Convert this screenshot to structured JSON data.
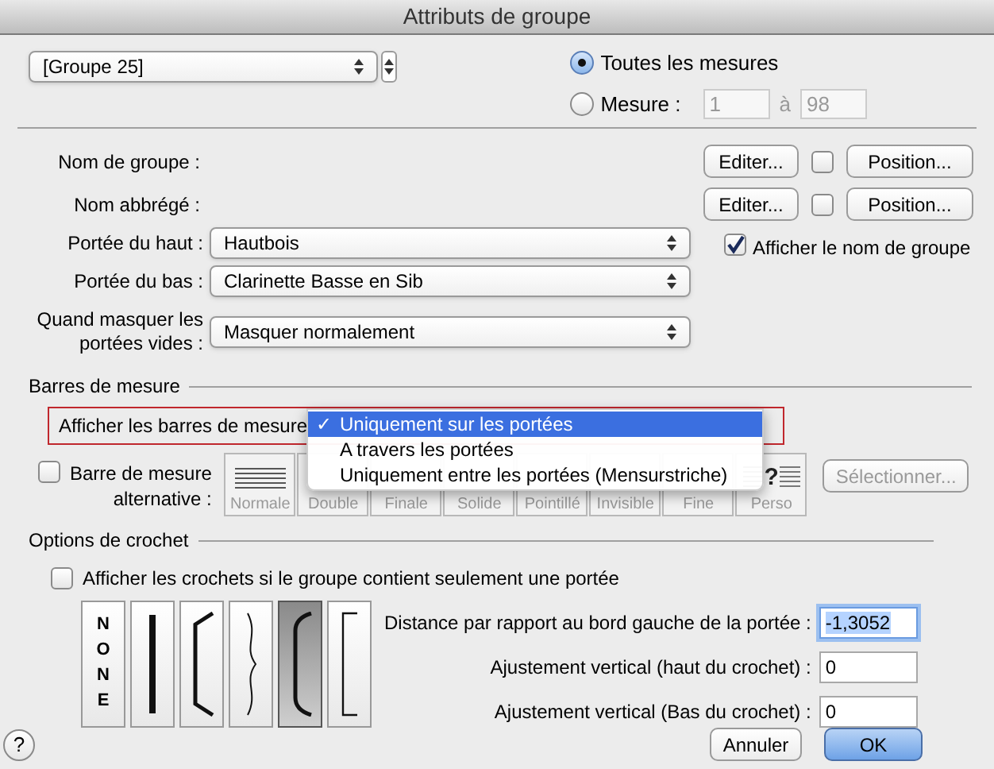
{
  "window": {
    "title": "Attributs de groupe"
  },
  "group_select": {
    "value": "[Groupe 25]"
  },
  "range": {
    "options": [
      {
        "label": "Toutes les mesures",
        "selected": true
      },
      {
        "label": "Mesure :",
        "selected": false
      }
    ],
    "from": "1",
    "to_label": "à",
    "to": "98"
  },
  "names": [
    {
      "label": "Nom de groupe :",
      "edit_button": "Editer...",
      "checked": false,
      "position_button": "Position..."
    },
    {
      "label": "Nom abbrégé :",
      "edit_button": "Editer...",
      "checked": false,
      "position_button": "Position..."
    }
  ],
  "staves": [
    {
      "label": "Portée du haut :",
      "value": "Hautbois"
    },
    {
      "label": "Portée du bas :",
      "value": "Clarinette Basse en Sib"
    },
    {
      "label": "Quand masquer les\nportées vides :",
      "value": "Masquer normalement"
    }
  ],
  "show_group_name": {
    "label": "Afficher le nom de groupe",
    "checked": true
  },
  "barlines": {
    "title": "Barres de mesure",
    "show_label": "Afficher les barres de mesure",
    "check_mark": "✓",
    "menu": [
      {
        "label": "Uniquement sur les portées",
        "selected": true
      },
      {
        "label": "A travers les portées",
        "selected": false
      },
      {
        "label": "Uniquement entre les portées (Mensurstriche)",
        "selected": false
      }
    ],
    "alternative": {
      "label": "Barre de mesure\nalternative :",
      "checked": false
    },
    "styles": [
      {
        "label": "Normale",
        "kind": "normal"
      },
      {
        "label": "Double",
        "kind": "double"
      },
      {
        "label": "Finale",
        "kind": "final"
      },
      {
        "label": "Solide",
        "kind": "solid"
      },
      {
        "label": "Pointillé",
        "kind": "dotted"
      },
      {
        "label": "Invisible",
        "kind": "invisible"
      },
      {
        "label": "Fine",
        "kind": "thin"
      },
      {
        "label": "Perso",
        "kind": "custom",
        "symbol": "?"
      }
    ],
    "select_button": {
      "label": "Sélectionner...",
      "disabled": true
    }
  },
  "brackets": {
    "title": "Options de crochet",
    "single_staff": {
      "label": "Afficher les crochets si le groupe contient seulement une portée",
      "checked": false
    },
    "styles": [
      {
        "kind": "none",
        "label": "NONE",
        "selected": false
      },
      {
        "kind": "line",
        "selected": false
      },
      {
        "kind": "bracket",
        "selected": false
      },
      {
        "kind": "brace",
        "selected": false
      },
      {
        "kind": "curved",
        "selected": true
      },
      {
        "kind": "square",
        "selected": false
      }
    ],
    "fields": [
      {
        "label": "Distance par rapport au bord gauche de la portée :",
        "value": "-1,3052",
        "focused": true
      },
      {
        "label": "Ajustement vertical (haut du crochet) :",
        "value": "0",
        "focused": false
      },
      {
        "label": "Ajustement vertical (Bas du crochet) :",
        "value": "0",
        "focused": false
      }
    ]
  },
  "buttons": [
    {
      "label": "Annuler",
      "kind": "cancel"
    },
    {
      "label": "OK",
      "kind": "default"
    }
  ],
  "help": "?"
}
